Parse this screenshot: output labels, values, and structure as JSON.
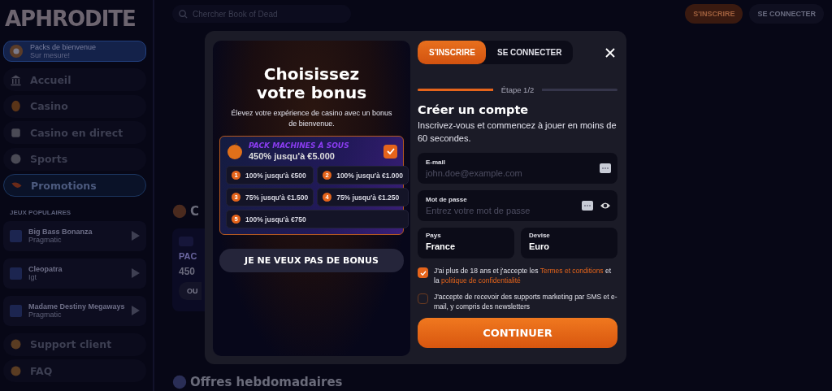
{
  "sidebar": {
    "logo": "APHRODITE",
    "promo": {
      "title": "Packs de bienvenue",
      "subtitle": "Sur mesure!"
    },
    "nav": [
      {
        "label": "Accueil",
        "selected": false
      },
      {
        "label": "Casino",
        "selected": false
      },
      {
        "label": "Casino en direct",
        "selected": false
      },
      {
        "label": "Sports",
        "selected": false
      },
      {
        "label": "Promotions",
        "selected": true
      }
    ],
    "section_title": "JEUX POPULAIRES",
    "games": [
      {
        "title": "Big Bass Bonanza",
        "provider": "Pragmatic"
      },
      {
        "title": "Cleopatra",
        "provider": "Igt"
      },
      {
        "title": "Madame Destiny Megaways",
        "provider": "Pragmatic"
      }
    ],
    "footer_nav": [
      {
        "label": "Support client"
      },
      {
        "label": "FAQ"
      }
    ]
  },
  "header": {
    "search": {
      "placeholder": "Chercher Book of Dead"
    },
    "buttons": [
      {
        "label": "S'INSCRIRE",
        "kind": "primary"
      },
      {
        "label": "SE CONNECTER",
        "kind": "secondary"
      }
    ]
  },
  "content": {
    "section_heading": "C",
    "card": {
      "title": "PAC",
      "amount": "450",
      "button": "OU"
    },
    "weekly_heading": "Offres hebdomadaires"
  },
  "modal": {
    "bonus": {
      "title": "Choisissez votre bonus",
      "subtitle": "Élevez votre expérience de casino avec un bonus de bienvenue.",
      "pack": {
        "name": "PACK MACHINES À SOUS",
        "amount": "450% jusqu'à €5.000",
        "selected": true,
        "steps": [
          {
            "number": "1",
            "text": "100% jusqu'à €500"
          },
          {
            "number": "2",
            "text": "100% jusqu'à €1.000"
          },
          {
            "number": "3",
            "text": "75% jusqu'à €1.500"
          },
          {
            "number": "4",
            "text": "75% jusqu'à €1.250"
          },
          {
            "number": "5",
            "text": "100% jusqu'à €750"
          }
        ]
      },
      "decline": "JE NE VEUX PAS DE BONUS"
    },
    "tabs": [
      {
        "label": "S'INSCRIRE",
        "selected": true
      },
      {
        "label": "SE CONNECTER",
        "selected": false
      }
    ],
    "step": {
      "label": "Étape 1/2",
      "level": 0.5
    },
    "form": {
      "title": "Créer un compte",
      "subtitle": "Inscrivez-vous et commencez à jouer en moins de 60 secondes.",
      "fields": [
        {
          "label": "E-mail",
          "placeholder": "john.doe@example.com",
          "kind": "email"
        },
        {
          "label": "Mot de passe",
          "placeholder": "Entrez votre mot de passe",
          "kind": "password"
        }
      ],
      "selects": [
        {
          "label": "Pays",
          "value": "France"
        },
        {
          "label": "Devise",
          "value": "Euro"
        }
      ],
      "consents": [
        {
          "checked": true,
          "parts": [
            {
              "kind": "text",
              "text": "J'ai plus de 18 ans et j'accepte les "
            },
            {
              "kind": "link",
              "text": "Termes et conditions"
            },
            {
              "kind": "text",
              "text": " et la "
            },
            {
              "kind": "link",
              "text": "politique de confidentialité"
            }
          ]
        },
        {
          "checked": false,
          "parts": [
            {
              "kind": "text",
              "text": "J'accepte de recevoir des supports marketing par SMS et e-mail, y compris des newsletters"
            }
          ]
        }
      ],
      "submit": "CONTINUER"
    }
  }
}
